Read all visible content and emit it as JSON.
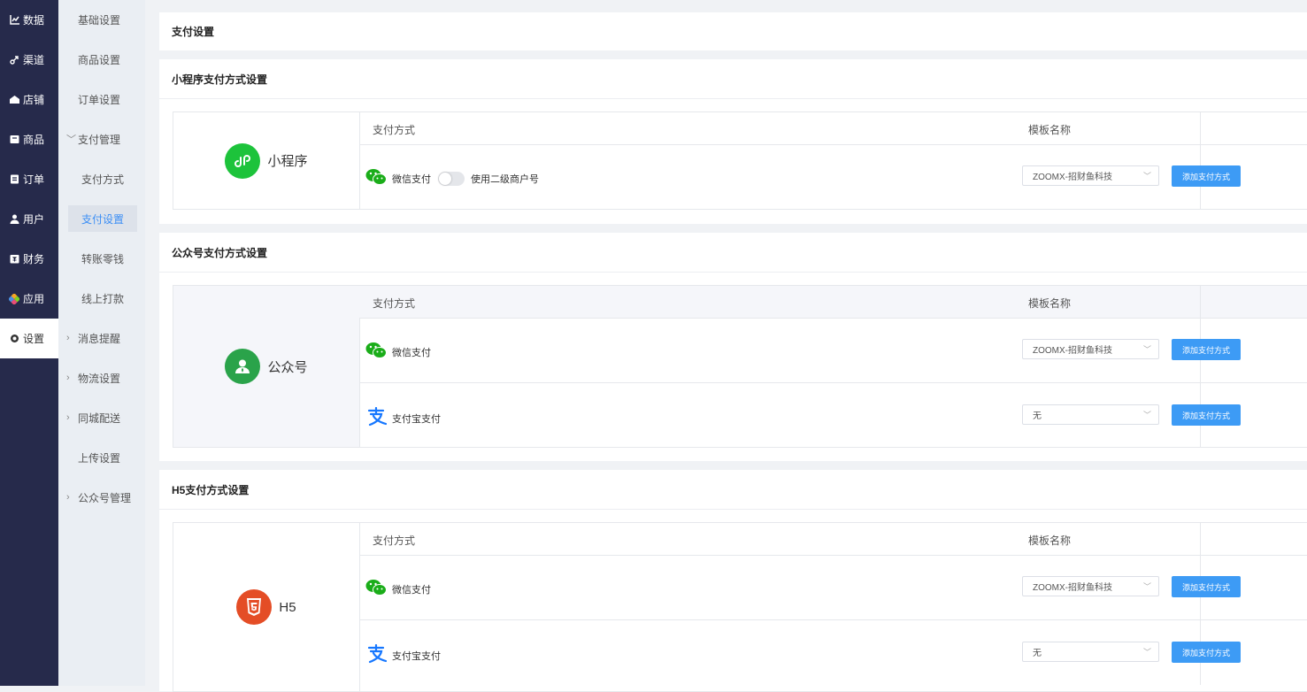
{
  "nav": {
    "items": [
      {
        "label": "数据",
        "icon": "chart-icon"
      },
      {
        "label": "渠道",
        "icon": "channel-icon"
      },
      {
        "label": "店铺",
        "icon": "store-icon"
      },
      {
        "label": "商品",
        "icon": "product-icon"
      },
      {
        "label": "订单",
        "icon": "order-icon"
      },
      {
        "label": "用户",
        "icon": "user-icon"
      },
      {
        "label": "财务",
        "icon": "finance-icon"
      },
      {
        "label": "应用",
        "icon": "apps-icon"
      },
      {
        "label": "设置",
        "icon": "settings-icon"
      }
    ]
  },
  "subnav": {
    "items": [
      {
        "label": "基础设置"
      },
      {
        "label": "商品设置"
      },
      {
        "label": "订单设置"
      },
      {
        "label": "支付管理"
      },
      {
        "label": "支付方式"
      },
      {
        "label": "支付设置"
      },
      {
        "label": "转账零钱"
      },
      {
        "label": "线上打款"
      },
      {
        "label": "消息提醒"
      },
      {
        "label": "物流设置"
      },
      {
        "label": "同城配送"
      },
      {
        "label": "上传设置"
      },
      {
        "label": "公众号管理"
      }
    ]
  },
  "page": {
    "title": "支付设置"
  },
  "columns": {
    "method": "支付方式",
    "template": "模板名称"
  },
  "sections": {
    "mini": {
      "title": "小程序支付方式设置",
      "name": "小程序",
      "wechat": {
        "label": "微信支付",
        "toggle_label": "使用二级商户号",
        "select": "ZOOMX-招财鱼科技",
        "button": "添加支付方式"
      }
    },
    "official": {
      "title": "公众号支付方式设置",
      "name": "公众号",
      "wechat": {
        "label": "微信支付",
        "select": "ZOOMX-招财鱼科技",
        "button": "添加支付方式"
      },
      "alipay": {
        "label": "支付宝支付",
        "select": "无",
        "button": "添加支付方式"
      }
    },
    "h5": {
      "title": "H5支付方式设置",
      "name": "H5",
      "wechat": {
        "label": "微信支付",
        "select": "ZOOMX-招财鱼科技",
        "button": "添加支付方式"
      },
      "alipay": {
        "label": "支付宝支付",
        "select": "无",
        "button": "添加支付方式"
      }
    }
  },
  "colors": {
    "nav_bg": "#262a4b",
    "accent": "#3d9bf5",
    "wechat_green": "#1aad19",
    "alipay_blue": "#1677ff",
    "html5_orange": "#e44d26"
  }
}
